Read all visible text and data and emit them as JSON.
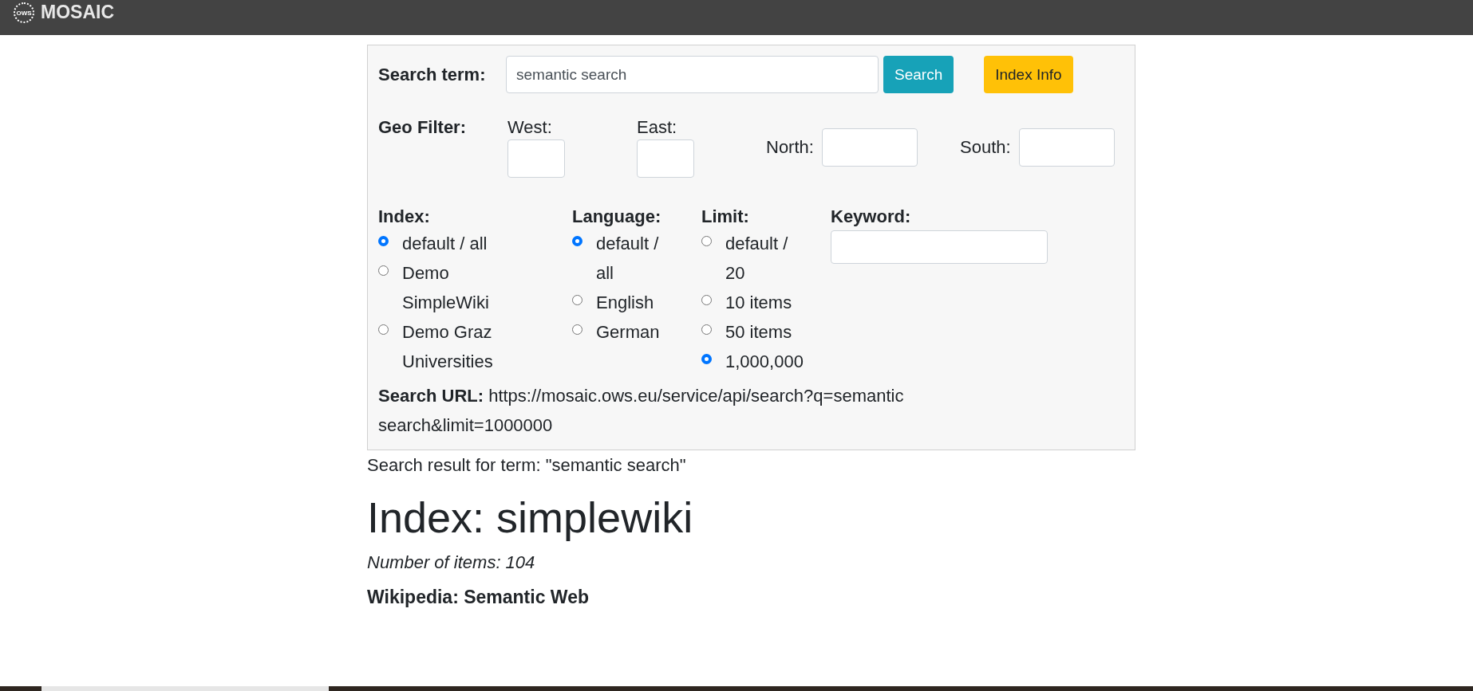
{
  "navbar": {
    "logo_mark": "OWS",
    "brand": "MOSAIC"
  },
  "search_form": {
    "search_term": {
      "label": "Search term:",
      "value": "semantic search"
    },
    "buttons": [
      {
        "label": "Search",
        "kind": "primary"
      },
      {
        "label": "Index Info",
        "kind": "warning"
      }
    ],
    "geo_filter": {
      "label": "Geo Filter:",
      "fields": [
        {
          "label": "West:",
          "kind": "stacked"
        },
        {
          "label": "East:",
          "kind": "stacked"
        },
        {
          "label": "North:",
          "kind": "inline"
        },
        {
          "label": "South:",
          "kind": "inline"
        }
      ]
    },
    "option_groups": [
      {
        "label": "Index:",
        "options": [
          {
            "label": "default / all",
            "selected": true
          },
          {
            "label": "Demo SimpleWiki",
            "selected": false
          },
          {
            "label": "Demo Graz Universities",
            "selected": false
          }
        ]
      },
      {
        "label": "Language:",
        "options": [
          {
            "label": "default / all",
            "selected": true
          },
          {
            "label": "English",
            "selected": false
          },
          {
            "label": "German",
            "selected": false
          }
        ]
      },
      {
        "label": "Limit:",
        "options": [
          {
            "label": "default / 20",
            "selected": false
          },
          {
            "label": "10 items",
            "selected": false
          },
          {
            "label": "50 items",
            "selected": false
          },
          {
            "label": "1,000,000",
            "selected": true
          }
        ]
      }
    ],
    "keyword": {
      "label": "Keyword:"
    },
    "search_url": "**Search URL:** https://mosaic.ows.eu/service/api/search?q=semantic search&limit=1000000"
  },
  "results": {
    "summary": "Search result for term: \"semantic search\"",
    "index_title": "Index: simplewiki",
    "item_count": "Number of items: 104",
    "first_result": "Wikipedia: Semantic Web"
  }
}
